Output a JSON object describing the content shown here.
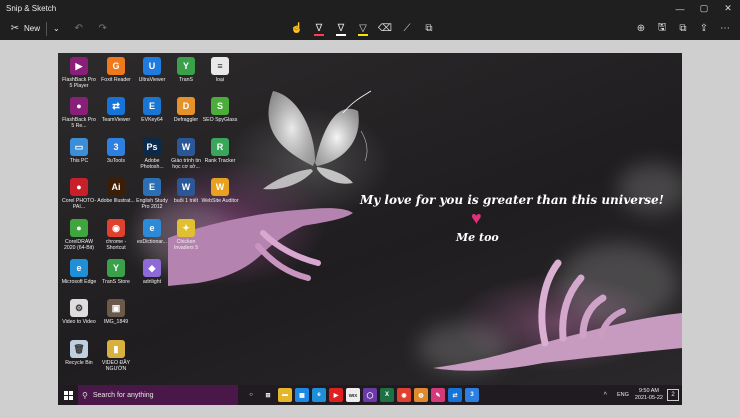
{
  "window": {
    "title": "Snip & Sketch",
    "minimize": "—",
    "maximize": "▢",
    "close": "✕"
  },
  "toolbar": {
    "new_label": "New",
    "chevron": "⌄",
    "undo": "↶",
    "redo": "↷",
    "touch": "☝",
    "ballpoint": "∇",
    "pencil": "∇",
    "highlighter": "▽",
    "eraser": "⌫",
    "ruler": "⟋",
    "crop": "⧉",
    "zoom": "⊕",
    "save": "🖫",
    "copy": "⧉",
    "share": "⇪",
    "more": "⋯"
  },
  "wallpaper": {
    "message": "My love for you is greater than this universe!",
    "heart": "♥",
    "reply": "Me too"
  },
  "desktop_icons": [
    {
      "label": "FlashBack Pro 5 Player",
      "glyph": "▶",
      "color": "#8a1f7a"
    },
    {
      "label": "Foxit Reader",
      "glyph": "G",
      "color": "#ef7a1e"
    },
    {
      "label": "UltraViewer",
      "glyph": "U",
      "color": "#1e7be0"
    },
    {
      "label": "TranS",
      "glyph": "Y",
      "color": "#3aa04a"
    },
    {
      "label": "loại",
      "glyph": "≡",
      "color": "#e8e8e8"
    },
    {
      "label": "FlashBack Pro 5 Re...",
      "glyph": "●",
      "color": "#8a1f7a"
    },
    {
      "label": "TeamViewer",
      "glyph": "⇄",
      "color": "#1673d8"
    },
    {
      "label": "EVKey64",
      "glyph": "E",
      "color": "#1976d2"
    },
    {
      "label": "Defraggler",
      "glyph": "D",
      "color": "#e5922a"
    },
    {
      "label": "SEO SpyGlass",
      "glyph": "S",
      "color": "#4cae3a"
    },
    {
      "label": "This PC",
      "glyph": "▭",
      "color": "#3a8fd8"
    },
    {
      "label": "3uTools",
      "glyph": "3",
      "color": "#2d7fe0"
    },
    {
      "label": "Adobe Photosh...",
      "glyph": "Ps",
      "color": "#0b2a4a"
    },
    {
      "label": "Giáo trình tin học cơ sở...",
      "glyph": "W",
      "color": "#2b5797"
    },
    {
      "label": "Rank Tracker",
      "glyph": "R",
      "color": "#3ba55c"
    },
    {
      "label": "Corel PHOTO-PAI...",
      "glyph": "●",
      "color": "#c8202a"
    },
    {
      "label": "Adobe Illustrat...",
      "glyph": "Ai",
      "color": "#3a1e05"
    },
    {
      "label": "English Study Pro 2012",
      "glyph": "E",
      "color": "#2c6fb5"
    },
    {
      "label": "buổi 1 triết",
      "glyph": "W",
      "color": "#2b5797"
    },
    {
      "label": "WebSite Auditor",
      "glyph": "W",
      "color": "#e8a020"
    },
    {
      "label": "CorelDRAW 2020 (64-Bit)",
      "glyph": "●",
      "color": "#3fa63f"
    },
    {
      "label": "chrome - Shortcut",
      "glyph": "◉",
      "color": "#e0412f"
    },
    {
      "label": "esDictionar...",
      "glyph": "e",
      "color": "#2c8ad8"
    },
    {
      "label": "Chicken Invaders 5",
      "glyph": "✦",
      "color": "#e0c030"
    },
    {
      "label": "Microsoft Edge",
      "glyph": "e",
      "color": "#1f8fd8"
    },
    {
      "label": "TranS Store",
      "glyph": "Y",
      "color": "#3aa04a"
    },
    {
      "label": "adrilight",
      "glyph": "◆",
      "color": "#8e6ad8"
    },
    {
      "label": "Video to Video",
      "glyph": "⚙",
      "color": "#dddddd"
    },
    {
      "label": "IMG_1849",
      "glyph": "▣",
      "color": "#6b5a4a"
    },
    {
      "label": "Recycle Bin",
      "glyph": "🗑",
      "color": "#bfcfe0"
    },
    {
      "label": "VIDEO ĐẦY NGƯỜN",
      "glyph": "▮",
      "color": "#d8b040"
    }
  ],
  "taskbar": {
    "search_placeholder": "Search for anything",
    "apps": [
      {
        "glyph": "○",
        "color": "#201b21"
      },
      {
        "glyph": "⊞",
        "color": "#201b21"
      },
      {
        "glyph": "▬",
        "color": "#e5b52a"
      },
      {
        "glyph": "▦",
        "color": "#1e88e5"
      },
      {
        "glyph": "e",
        "color": "#1f8fd8"
      },
      {
        "glyph": "▶",
        "color": "#e02020"
      },
      {
        "glyph": "WIX",
        "color": "#eeeeee"
      },
      {
        "glyph": "◯",
        "color": "#6a3aa8"
      },
      {
        "glyph": "X",
        "color": "#1e7145"
      },
      {
        "glyph": "◉",
        "color": "#e0412f"
      },
      {
        "glyph": "◍",
        "color": "#e08a30"
      },
      {
        "glyph": "✎",
        "color": "#d43a7a"
      },
      {
        "glyph": "⇄",
        "color": "#1673d8"
      },
      {
        "glyph": "3",
        "color": "#2d7fe0"
      }
    ],
    "tray_chevron": "^",
    "language": "ENG",
    "time": "9:50 AM",
    "date": "2021-05-22",
    "notification_count": "2"
  }
}
